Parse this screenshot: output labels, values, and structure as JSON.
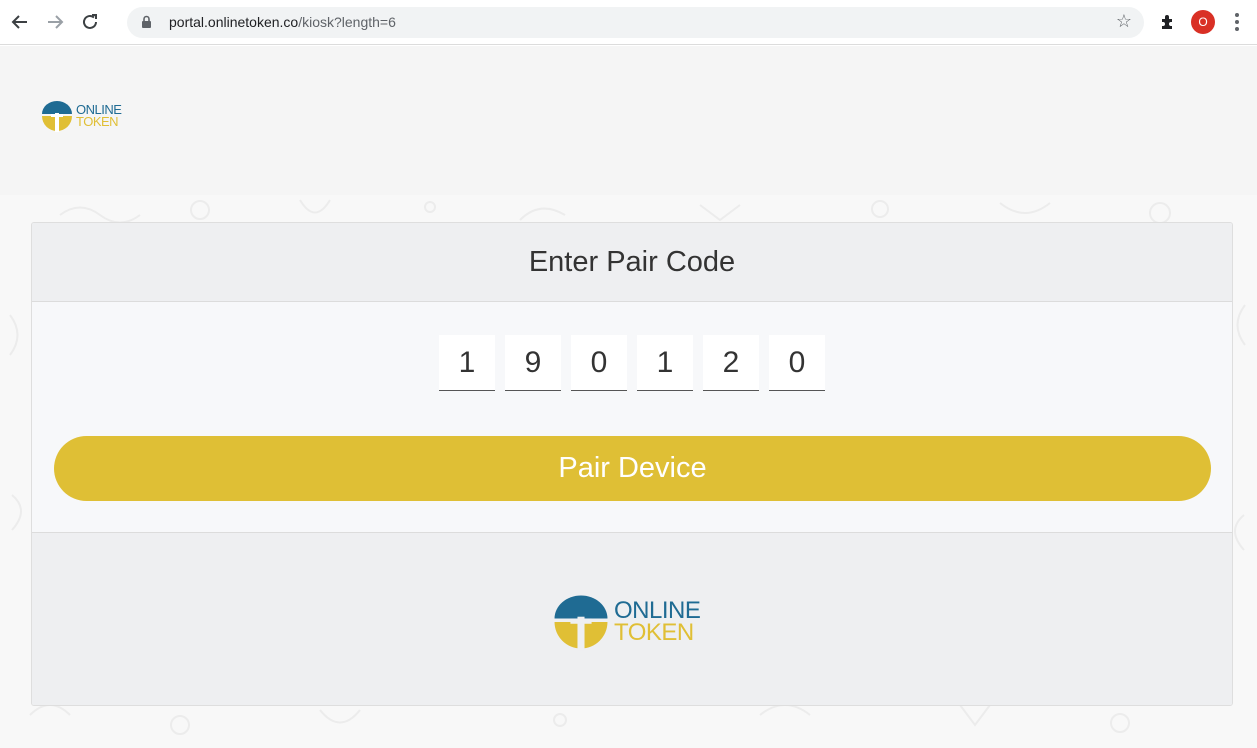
{
  "browser": {
    "url_host": "portal.onlinetoken.co",
    "url_path": "/kiosk?length=6",
    "profile_initial": "O"
  },
  "brand": {
    "line1": "ONLINE",
    "line2": "TOKEN",
    "blue": "#1f6b93",
    "yellow": "#e0bf35"
  },
  "card": {
    "title": "Enter Pair Code",
    "digits": [
      "1",
      "9",
      "0",
      "1",
      "2",
      "0"
    ],
    "button_label": "Pair Device"
  },
  "colors": {
    "accent": "#dfbf35"
  }
}
